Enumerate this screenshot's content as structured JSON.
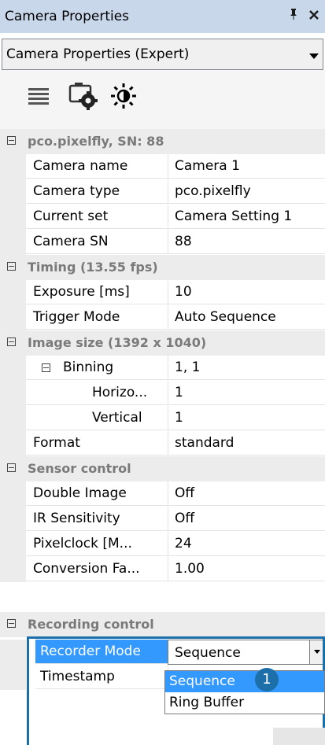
{
  "window": {
    "title": "Camera Properties",
    "pin_glyph": "չ",
    "close_glyph": "✕"
  },
  "view_select": {
    "value": "Camera Properties (Expert)"
  },
  "toolbar": {
    "icons": [
      "list-icon",
      "camera-settings-icon",
      "brightness-icon"
    ]
  },
  "categories": {
    "camera": "pco.pixelfly, SN: 88",
    "timing": "Timing (13.55 fps)",
    "image_size": "Image size (1392 x 1040)",
    "sensor": "Sensor control",
    "recording": "Recording control"
  },
  "props": {
    "camera_name": {
      "name": "Camera name",
      "value": "Camera 1"
    },
    "camera_type": {
      "name": "Camera type",
      "value": "pco.pixelfly"
    },
    "current_set": {
      "name": "Current set",
      "value": "Camera Setting 1"
    },
    "camera_sn": {
      "name": "Camera SN",
      "value": "88"
    },
    "exposure": {
      "name": "Exposure [ms]",
      "value": "10"
    },
    "trigger_mode": {
      "name": "Trigger Mode",
      "value": "Auto Sequence"
    },
    "binning": {
      "name": "Binning",
      "value": "1, 1"
    },
    "horizontal": {
      "name": "Horizo...",
      "value": "1"
    },
    "vertical": {
      "name": "Vertical",
      "value": "1"
    },
    "format": {
      "name": "Format",
      "value": "standard"
    },
    "double_image": {
      "name": "Double Image",
      "value": "Off"
    },
    "ir_sensitivity": {
      "name": "IR Sensitivity",
      "value": "Off"
    },
    "pixelclock": {
      "name": "Pixelclock [M...",
      "value": "24"
    },
    "conversion": {
      "name": "Conversion Fa...",
      "value": "1.00"
    },
    "recorder_mode": {
      "name": "Recorder Mode",
      "value": "Sequence"
    },
    "timestamp": {
      "name": "Timestamp",
      "value": ""
    }
  },
  "recorder_options": [
    "Sequence",
    "Ring Buffer"
  ],
  "badge": "1",
  "colors": {
    "title_bg": "#c8d7ea",
    "selection": "#3399ff",
    "callout": "#1c6fa8"
  }
}
